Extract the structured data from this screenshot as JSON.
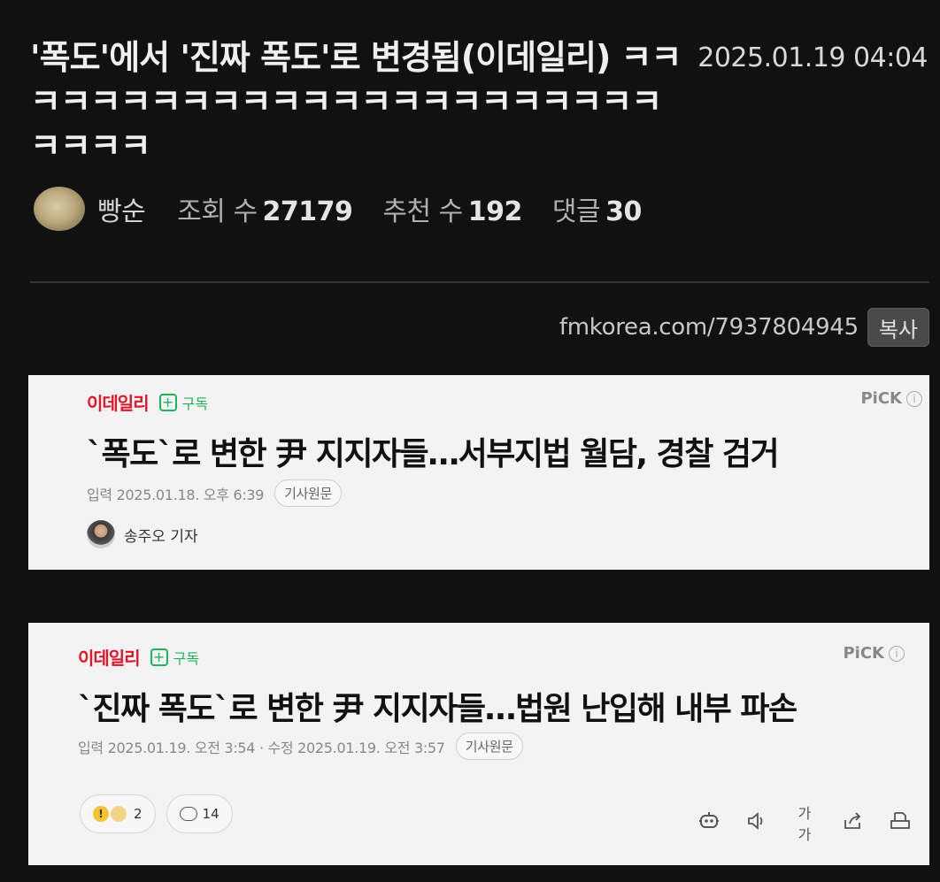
{
  "post": {
    "title": "'폭도'에서 '진짜 폭도'로 변경됨(이데일리) ㅋㅋㅋㅋㅋㅋㅋㅋㅋㅋㅋㅋㅋㅋㅋㅋㅋㅋㅋㅋㅋㅋㅋㅋㅋㅋㅋ",
    "date": "2025.01.19 04:04",
    "author": "빵순",
    "views_label": "조회 수",
    "views": "27179",
    "likes_label": "추천 수",
    "likes": "192",
    "comments_label": "댓글",
    "comments": "30"
  },
  "share": {
    "url": "fmkorea.com/7937804945",
    "copy_label": "복사"
  },
  "articles": [
    {
      "brand": "이데일리",
      "subscribe": "구독",
      "pick": "PiCK",
      "info": "i",
      "headline": "`폭도`로 변한 尹 지지자들…서부지법 월담, 경찰 검거",
      "dates": "입력 2025.01.18. 오후 6:39",
      "original_label": "기사원문",
      "reporter": "송주오 기자"
    },
    {
      "brand": "이데일리",
      "subscribe": "구독",
      "pick": "PiCK",
      "info": "i",
      "headline": "`진짜 폭도`로 변한 尹 지지자들…법원 난입해 내부 파손",
      "dates": "입력 2025.01.19. 오전 3:54 · 수정 2025.01.19. 오전 3:57",
      "original_label": "기사원문",
      "reactions_count": "2",
      "comments_count": "14",
      "font_size_label": "가가"
    }
  ],
  "icons": [
    "plus-icon",
    "info-icon",
    "reaction-emoji-icon",
    "comment-bubble-icon",
    "robot-summary-icon",
    "speaker-icon",
    "font-size-icon",
    "share-icon",
    "print-icon"
  ],
  "colors": {
    "background": "#111111",
    "brand_red": "#e0162b",
    "subscribe_green": "#1fb35a",
    "card_bg": "#f3f3f3"
  }
}
